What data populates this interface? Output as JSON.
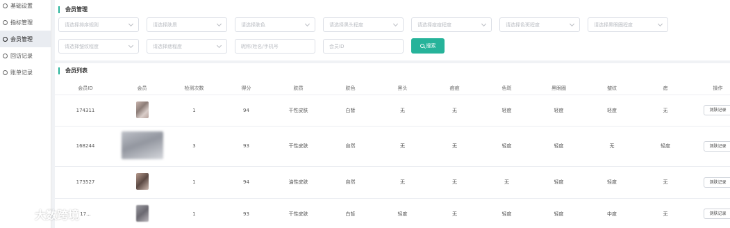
{
  "sidebar": {
    "items": [
      {
        "label": "基础设置",
        "active": false
      },
      {
        "label": "指标管理",
        "active": false
      },
      {
        "label": "会员管理",
        "active": true
      },
      {
        "label": "回访记录",
        "active": false
      },
      {
        "label": "账单记录",
        "active": false
      }
    ]
  },
  "filters": {
    "title": "会员管理",
    "selects": [
      "请选择排序规则",
      "请选择肤质",
      "请选择肤色",
      "请选择黑头程度",
      "请选择痘痘程度",
      "请选择色斑程度",
      "请选择黑眼圈程度",
      "请选择皱纹程度",
      "请选择痣程度"
    ],
    "name_placeholder": "昵称/姓名/手机号",
    "id_placeholder": "会员ID",
    "search_label": "搜索"
  },
  "list": {
    "title": "会员列表",
    "columns": [
      "会员ID",
      "会员",
      "检测次数",
      "得分",
      "肤质",
      "肤色",
      "黑头",
      "痘痘",
      "色斑",
      "黑眼圈",
      "皱纹",
      "痣",
      "操作"
    ],
    "rows": [
      {
        "id": "174311",
        "count": "1",
        "score": "94",
        "skin": "干性皮肤",
        "tone": "白皙",
        "blackhead": "无",
        "acne": "无",
        "spot": "轻度",
        "dark_circle": "轻度",
        "wrinkle": "轻度",
        "mole": "无",
        "action": "测肤记录"
      },
      {
        "id": "168244",
        "count": "3",
        "score": "93",
        "skin": "干性皮肤",
        "tone": "自然",
        "blackhead": "无",
        "acne": "无",
        "spot": "轻度",
        "dark_circle": "轻度",
        "wrinkle": "无",
        "mole": "轻度",
        "action": "测肤记录"
      },
      {
        "id": "173527",
        "count": "1",
        "score": "94",
        "skin": "油性皮肤",
        "tone": "自然",
        "blackhead": "无",
        "acne": "无",
        "spot": "无",
        "dark_circle": "轻度",
        "wrinkle": "轻度",
        "mole": "无",
        "action": "测肤记录"
      },
      {
        "id": "17...",
        "count": "1",
        "score": "93",
        "skin": "干性皮肤",
        "tone": "白皙",
        "blackhead": "轻度",
        "acne": "无",
        "spot": "轻度",
        "dark_circle": "轻度",
        "wrinkle": "中度",
        "mole": "无",
        "action": "测肤记录"
      }
    ]
  },
  "watermark": {
    "text": "大数跨境"
  },
  "colors": {
    "accent": "#26b39a",
    "background": "#f0f2f5"
  }
}
